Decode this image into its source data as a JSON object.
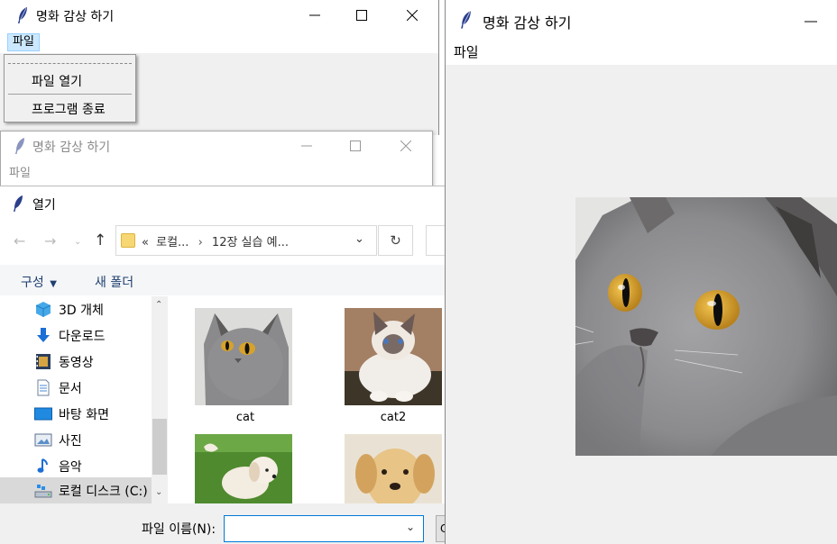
{
  "windows": {
    "main": {
      "title": "명화 감상 하기",
      "menu_file": "파일",
      "dropdown": {
        "open_file": "파일 열기",
        "exit_program": "프로그램 종료"
      }
    },
    "background": {
      "title": "명화 감상 하기",
      "menu_file": "파일"
    },
    "viewer": {
      "title": "명화 감상 하기",
      "menu_file": "파일"
    }
  },
  "open_dialog": {
    "title": "열기",
    "address": {
      "prefix": "«",
      "segment1": "로컬...",
      "separator": "›",
      "segment2": "12장 실습 예..."
    },
    "organize_label": "구성",
    "new_folder_label": "새 폴더",
    "nav_items": [
      {
        "label": "3D 개체",
        "icon": "cube-3d-icon"
      },
      {
        "label": "다운로드",
        "icon": "download-arrow-icon"
      },
      {
        "label": "동영상",
        "icon": "film-icon"
      },
      {
        "label": "문서",
        "icon": "document-icon"
      },
      {
        "label": "바탕 화면",
        "icon": "desktop-icon"
      },
      {
        "label": "사진",
        "icon": "picture-icon"
      },
      {
        "label": "음악",
        "icon": "music-note-icon"
      },
      {
        "label": "로컬 디스크 (C:)",
        "icon": "local-disk-icon"
      }
    ],
    "files": [
      {
        "name": "cat"
      },
      {
        "name": "cat2"
      },
      {
        "name": ""
      },
      {
        "name": ""
      }
    ],
    "filename_label": "파일 이름(N):",
    "filename_value": "",
    "open_button_partial": "C"
  },
  "colors": {
    "menu_highlight": "#cce8ff",
    "focus_blue": "#0078d7",
    "command_text": "#1e3f70",
    "window_bg": "#f0f0f0"
  }
}
